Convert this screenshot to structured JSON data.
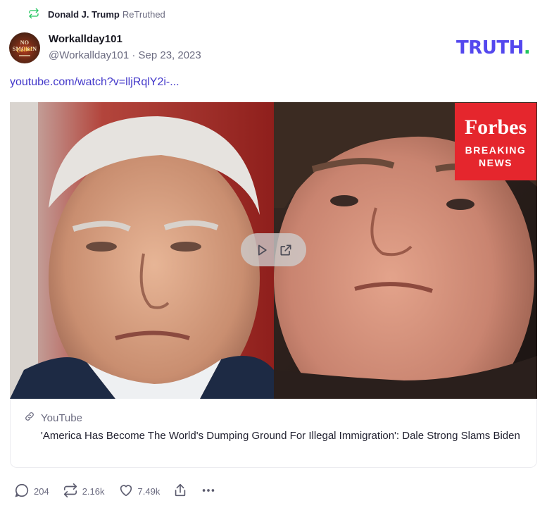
{
  "retruth": {
    "user": "Donald J. Trump",
    "action": "ReTruthed",
    "icon": "retruth-icon"
  },
  "post": {
    "avatar_text": {
      "top": "NO SMOKIN",
      "script": "Cellar"
    },
    "display_name": "Workallday101",
    "handle_line": "@Workallday101 · Sep 23, 2023",
    "link_text": "youtube.com/watch?v=lljRqlY2i-..."
  },
  "brand": {
    "logo": "TRUTH",
    "logo_dot": ".",
    "color": "#5448ee",
    "dot_color": "#22c55e"
  },
  "media": {
    "badge_brand": "Forbes",
    "badge_line1": "BREAKING",
    "badge_line2": "NEWS",
    "badge_color": "#e5262d",
    "controls": [
      "play-icon",
      "external-link-icon"
    ]
  },
  "card": {
    "source": "YouTube",
    "title": "'America Has Become The World's Dumping Ground For Illegal Immigration': Dale Strong Slams Biden"
  },
  "actions": {
    "replies": "204",
    "retruths": "2.16k",
    "likes": "7.49k",
    "share_icon": "share-icon",
    "more_icon": "more-icon"
  }
}
